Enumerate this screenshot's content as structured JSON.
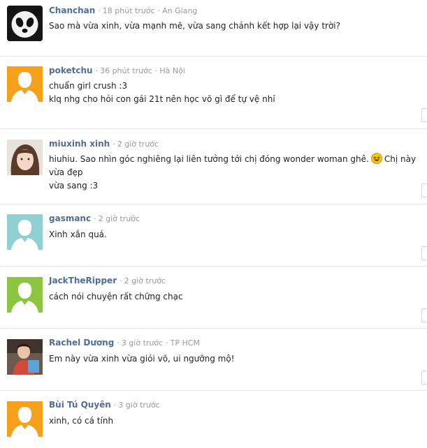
{
  "comments": [
    {
      "user": "Chanchan",
      "time": "18 phút trước",
      "location": "An Giang",
      "lines": [
        "Sao mà vừa xinh, vừa mạnh mẽ, vừa sang chảnh kết hợp lại vậy trời?"
      ],
      "avatar": "panda-avatar"
    },
    {
      "user": "poketchu",
      "time": "36 phút trước",
      "location": "Hà Nội",
      "lines": [
        "chuẩn girl crush :3",
        "klq nhg cho hỏi con gái 21t nên học võ gì để tự vệ nhỉ"
      ],
      "avatar": "default-avatar",
      "avatar_color": "#f7a11a"
    },
    {
      "user": "miuxinh xinh",
      "time": "2 giờ trước",
      "location": "",
      "line1_a": "hiuhiu. Sao nhìn góc nghiêng lại liên tưởng tới chị đóng wonder woman ghê.",
      "line1_b": "Chị này vừa đẹp",
      "line2": "vừa sang :3",
      "avatar": "photo-avatar"
    },
    {
      "user": "gasmanc",
      "time": "2 giờ trước",
      "location": "",
      "lines": [
        "Xinh xắn quá."
      ],
      "avatar": "default-avatar",
      "avatar_color": "#8fd1d3"
    },
    {
      "user": "JackTheRipper",
      "time": "2 giờ trước",
      "location": "",
      "lines": [
        "cách nói chuyện rất chững chạc"
      ],
      "avatar": "default-avatar",
      "avatar_color": "#8cc63f"
    },
    {
      "user": "Rachel Dương",
      "time": "3 giờ trước",
      "location": "TP HCM",
      "lines": [
        "Em này vừa xinh vừa giỏi võ, ui ngưỡng mộ!"
      ],
      "avatar": "photo-avatar"
    },
    {
      "user": "Bùi Tú Quyên",
      "time": "3 giờ trước",
      "location": "",
      "lines": [
        "xinh, có cá tính"
      ],
      "avatar": "default-avatar",
      "avatar_color": "#f7a11a"
    }
  ]
}
